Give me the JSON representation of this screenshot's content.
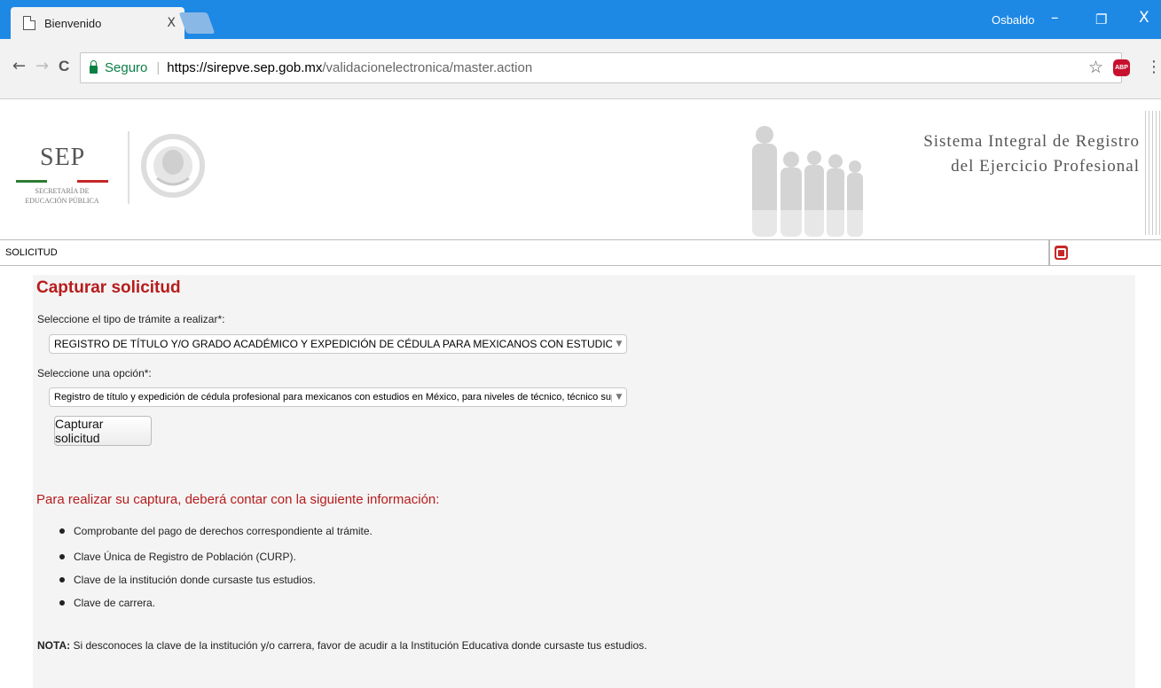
{
  "browser": {
    "tab_title": "Bienvenido",
    "tab_close": "X",
    "user": "Osbaldo",
    "minimize": "–",
    "maximize": "❐",
    "close": "X",
    "back": "←",
    "forward": "→",
    "reload": "C",
    "secure_label": "Seguro",
    "separator": "|",
    "url_host": "https://sirepve.sep.gob.mx",
    "url_path": "/validacionelectronica/master.action",
    "bookmark_icon": "☆",
    "abp_label": "ABP",
    "menu_icon": "⋮"
  },
  "header": {
    "sep_logo_text": "SEP",
    "sep_sub_line1": "SECRETARÍA DE",
    "sep_sub_line2": "EDUCACIÓN PÚBLICA",
    "system_title_line1": "Sistema Integral de Registro",
    "system_title_line2": "del Ejercicio Profesional",
    "colors": {
      "green": "#2e7d32",
      "red": "#c62828",
      "gray": "#777777"
    }
  },
  "section_bar": {
    "label": "SOLICITUD"
  },
  "main": {
    "title": "Capturar solicitud",
    "tramite_label": "Seleccione el tipo de trámite a realizar*:",
    "tramite_value": "REGISTRO DE TÍTULO Y/O GRADO ACADÉMICO Y EXPEDICIÓN DE CÉDULA PARA MEXICANOS CON ESTUDIOS EN MÉXICO",
    "opcion_label": "Seleccione una opción*:",
    "opcion_value": "Registro de título y expedición de cédula profesional para mexicanos con estudios en México, para niveles de técnico, técnico superior",
    "dropdown_arrow": "▼",
    "capture_button": "Capturar solicitud",
    "info_title": "Para realizar su captura, deberá contar con la siguiente información:",
    "requirements": [
      "Comprobante del pago de derechos correspondiente al trámite.",
      "Clave Única de Registro de Población (CURP).",
      "Clave de la institución donde cursaste tus estudios.",
      "Clave de carrera."
    ],
    "nota_label": "NOTA:",
    "nota_text": " Si desconoces la clave de la institución y/o carrera, favor de acudir a la Institución Educativa donde cursaste tus estudios."
  },
  "accent_color": "#b71c1c",
  "chrome_color": "#1e88e5"
}
